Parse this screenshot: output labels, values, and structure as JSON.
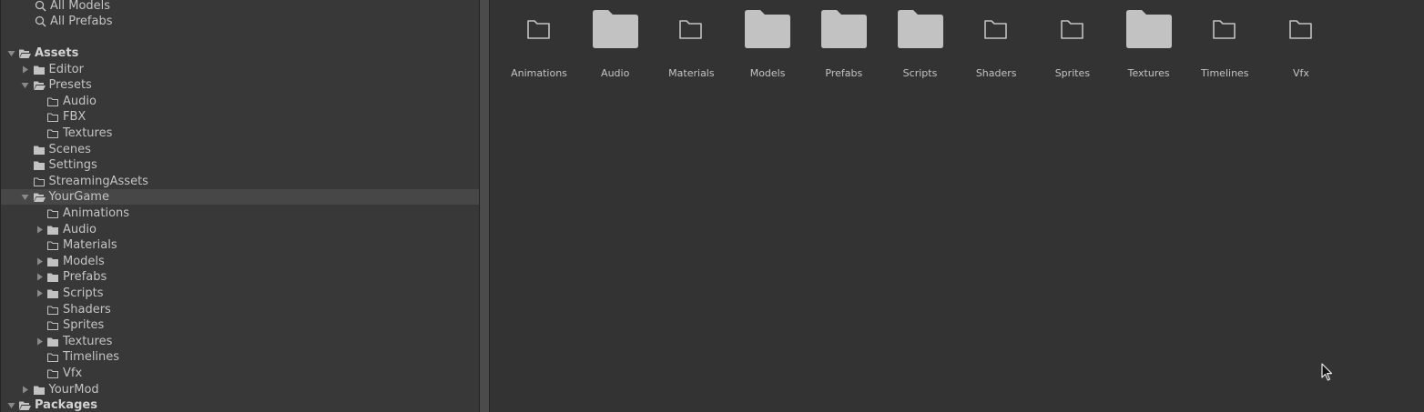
{
  "favorites": [
    {
      "label": "All Models",
      "icon": "search-icon"
    },
    {
      "label": "All Prefabs",
      "icon": "search-icon"
    }
  ],
  "tree": [
    {
      "label": "Assets",
      "icon": "folder-open-icon",
      "foldout": "expanded",
      "bold": true,
      "depth": 0
    },
    {
      "label": "Editor",
      "icon": "folder-filled-icon",
      "foldout": "collapsed",
      "depth": 1
    },
    {
      "label": "Presets",
      "icon": "folder-open-icon",
      "foldout": "expanded",
      "depth": 1
    },
    {
      "label": "Audio",
      "icon": "folder-empty-icon",
      "foldout": "none",
      "depth": 2
    },
    {
      "label": "FBX",
      "icon": "folder-empty-icon",
      "foldout": "none",
      "depth": 2
    },
    {
      "label": "Textures",
      "icon": "folder-empty-icon",
      "foldout": "none",
      "depth": 2
    },
    {
      "label": "Scenes",
      "icon": "folder-filled-icon",
      "foldout": "none",
      "depth": 1
    },
    {
      "label": "Settings",
      "icon": "folder-filled-icon",
      "foldout": "none",
      "depth": 1
    },
    {
      "label": "StreamingAssets",
      "icon": "folder-empty-icon",
      "foldout": "none",
      "depth": 1
    },
    {
      "label": "YourGame",
      "icon": "folder-open-icon",
      "foldout": "expanded",
      "depth": 1,
      "selected": true
    },
    {
      "label": "Animations",
      "icon": "folder-empty-icon",
      "foldout": "none",
      "depth": 2
    },
    {
      "label": "Audio",
      "icon": "folder-filled-icon",
      "foldout": "collapsed",
      "depth": 2
    },
    {
      "label": "Materials",
      "icon": "folder-empty-icon",
      "foldout": "none",
      "depth": 2
    },
    {
      "label": "Models",
      "icon": "folder-filled-icon",
      "foldout": "collapsed",
      "depth": 2
    },
    {
      "label": "Prefabs",
      "icon": "folder-filled-icon",
      "foldout": "collapsed",
      "depth": 2
    },
    {
      "label": "Scripts",
      "icon": "folder-filled-icon",
      "foldout": "collapsed",
      "depth": 2
    },
    {
      "label": "Shaders",
      "icon": "folder-empty-icon",
      "foldout": "none",
      "depth": 2
    },
    {
      "label": "Sprites",
      "icon": "folder-empty-icon",
      "foldout": "none",
      "depth": 2
    },
    {
      "label": "Textures",
      "icon": "folder-filled-icon",
      "foldout": "collapsed",
      "depth": 2
    },
    {
      "label": "Timelines",
      "icon": "folder-empty-icon",
      "foldout": "none",
      "depth": 2
    },
    {
      "label": "Vfx",
      "icon": "folder-empty-icon",
      "foldout": "none",
      "depth": 2
    },
    {
      "label": "YourMod",
      "icon": "folder-filled-icon",
      "foldout": "collapsed",
      "depth": 1
    },
    {
      "label": "Packages",
      "icon": "folder-open-icon",
      "foldout": "expanded",
      "bold": true,
      "depth": 0
    }
  ],
  "grid": [
    {
      "label": "Animations",
      "icon": "folder-empty-icon"
    },
    {
      "label": "Audio",
      "icon": "folder-filled-icon"
    },
    {
      "label": "Materials",
      "icon": "folder-empty-icon"
    },
    {
      "label": "Models",
      "icon": "folder-filled-icon"
    },
    {
      "label": "Prefabs",
      "icon": "folder-filled-icon"
    },
    {
      "label": "Scripts",
      "icon": "folder-filled-icon"
    },
    {
      "label": "Shaders",
      "icon": "folder-empty-icon"
    },
    {
      "label": "Sprites",
      "icon": "folder-empty-icon"
    },
    {
      "label": "Textures",
      "icon": "folder-filled-icon"
    },
    {
      "label": "Timelines",
      "icon": "folder-empty-icon"
    },
    {
      "label": "Vfx",
      "icon": "folder-empty-icon"
    }
  ],
  "colors": {
    "tree_bg": "#383838",
    "grid_bg": "#333333",
    "selected_row": "#474747",
    "folder_fill": "#c2c2c2",
    "text": "#c4c4c4"
  }
}
